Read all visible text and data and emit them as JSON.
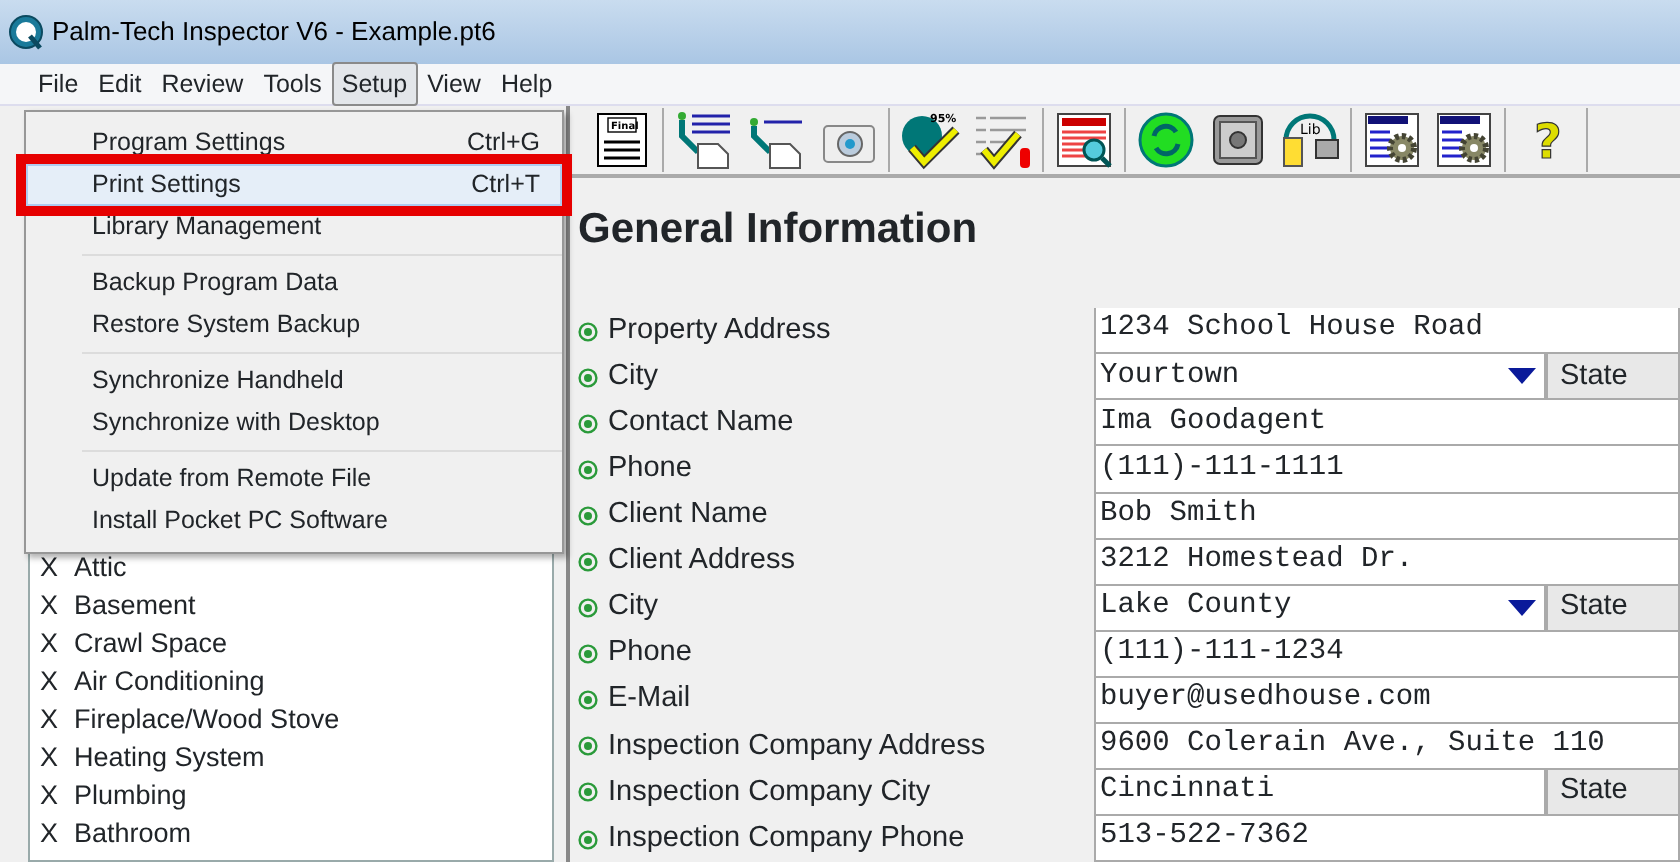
{
  "window": {
    "title": "Palm-Tech Inspector V6 - Example.pt6"
  },
  "menu_bar": [
    {
      "label": "File",
      "selected": false
    },
    {
      "label": "Edit",
      "selected": false
    },
    {
      "label": "Review",
      "selected": false
    },
    {
      "label": "Tools",
      "selected": false
    },
    {
      "label": "Setup",
      "selected": true
    },
    {
      "label": "View",
      "selected": false
    },
    {
      "label": "Help",
      "selected": false
    }
  ],
  "setup_menu": [
    [
      {
        "label": "Program Settings",
        "shortcut": "Ctrl+G",
        "selected": false,
        "outlined": false
      },
      {
        "label": "Print Settings",
        "shortcut": "Ctrl+T",
        "selected": true,
        "outlined": true
      },
      {
        "label": "Library Management",
        "selected": false,
        "outlined": false
      }
    ],
    [
      {
        "label": "Backup Program Data",
        "selected": false,
        "outlined": false
      },
      {
        "label": "Restore System Backup",
        "selected": false,
        "outlined": false
      }
    ],
    [
      {
        "label": "Synchronize Handheld",
        "selected": false,
        "outlined": false
      },
      {
        "label": "Synchronize with Desktop",
        "selected": false,
        "outlined": false
      }
    ],
    [
      {
        "label": "Update from Remote File",
        "selected": false,
        "outlined": false
      },
      {
        "label": "Install Pocket PC Software",
        "selected": false,
        "outlined": false
      }
    ]
  ],
  "toolbar": [
    [
      {
        "kind": "final",
        "label": "Final"
      }
    ],
    [
      {
        "kind": "doc-arrow-lines"
      },
      {
        "kind": "doc-arrow"
      },
      {
        "kind": "camera"
      }
    ],
    [
      {
        "kind": "pie-check",
        "label": "95%"
      },
      {
        "kind": "checklist"
      }
    ],
    [
      {
        "kind": "report-magnifier"
      }
    ],
    [
      {
        "kind": "refresh"
      },
      {
        "kind": "safe"
      },
      {
        "kind": "library",
        "label": "Lib"
      }
    ],
    [
      {
        "kind": "doc-gear"
      },
      {
        "kind": "doc-gear"
      }
    ],
    [
      {
        "kind": "help",
        "label": "?"
      }
    ]
  ],
  "sections": [
    {
      "mark": "X",
      "label": "Attic"
    },
    {
      "mark": "X",
      "label": "Basement"
    },
    {
      "mark": "X",
      "label": "Crawl Space"
    },
    {
      "mark": "X",
      "label": "Air Conditioning"
    },
    {
      "mark": "X",
      "label": "Fireplace/Wood Stove"
    },
    {
      "mark": "X",
      "label": "Heating System"
    },
    {
      "mark": "X",
      "label": "Plumbing"
    },
    {
      "mark": "X",
      "label": "Bathroom"
    }
  ],
  "heading": "General Information",
  "fields": [
    {
      "kind": "text",
      "label": "Property Address",
      "value": "1234 School House Road"
    },
    {
      "kind": "dropdown",
      "label": "City",
      "value": "Yourtown",
      "side": "State"
    },
    {
      "kind": "text",
      "label": "Contact Name",
      "value": "Ima Goodagent"
    },
    {
      "kind": "text",
      "label": "Phone",
      "value": "(111)-111-1111"
    },
    {
      "kind": "text",
      "label": "Client Name",
      "value": "Bob Smith"
    },
    {
      "kind": "text",
      "label": "Client Address",
      "value": "3212 Homestead Dr."
    },
    {
      "kind": "dropdown",
      "label": "City",
      "value": "Lake County",
      "side": "State"
    },
    {
      "kind": "text",
      "label": "Phone",
      "value": "(111)-111-1234"
    },
    {
      "kind": "text",
      "label": "E-Mail",
      "value": "buyer@usedhouse.com"
    },
    {
      "kind": "text",
      "label": "Inspection Company Address",
      "value": "9600 Colerain Ave., Suite 110"
    },
    {
      "kind": "plain",
      "label": "Inspection Company City",
      "value": "Cincinnati",
      "side": "State"
    },
    {
      "kind": "text",
      "label": "Inspection Company Phone",
      "value": "513-522-7362"
    }
  ]
}
